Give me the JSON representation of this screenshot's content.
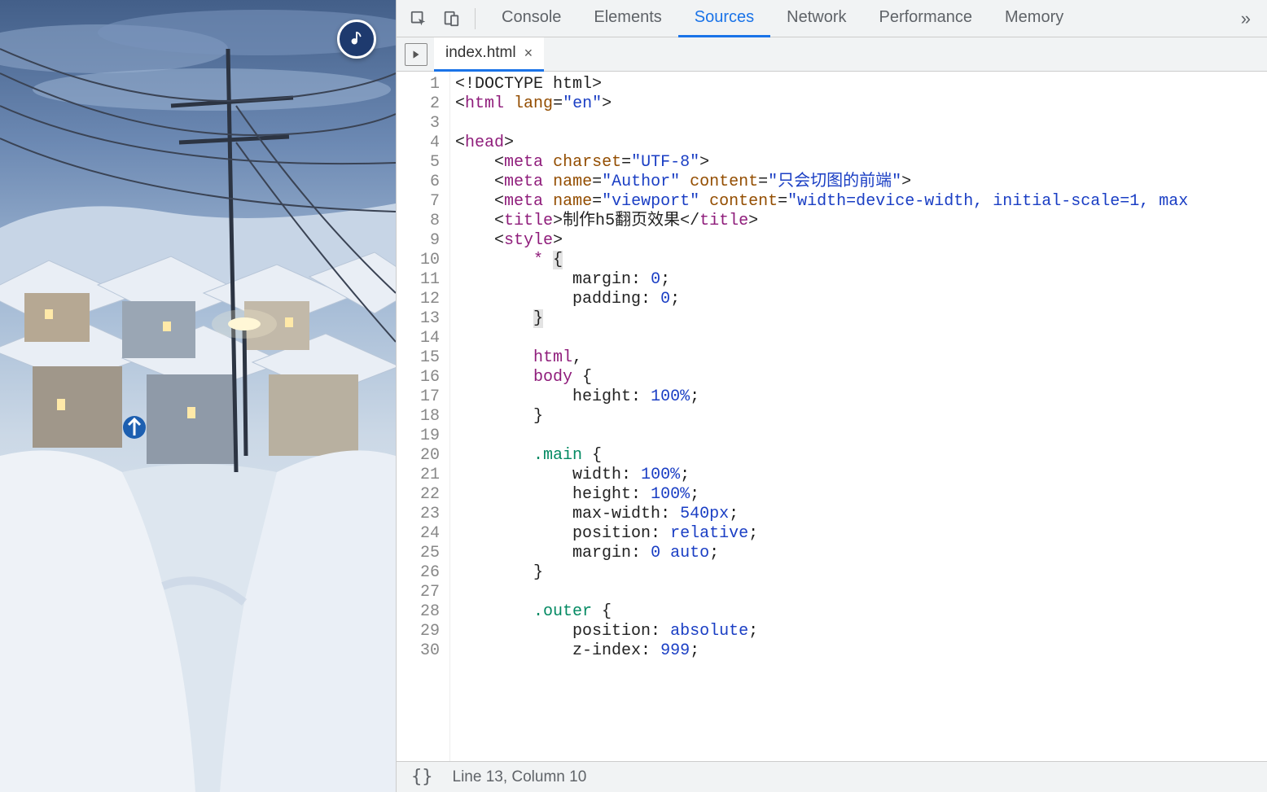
{
  "devtools": {
    "tabs": [
      "Console",
      "Elements",
      "Sources",
      "Network",
      "Performance",
      "Memory"
    ],
    "active_tab": "Sources",
    "more_glyph": "»"
  },
  "file": {
    "name": "index.html",
    "close_glyph": "×"
  },
  "status": {
    "braces": "{}",
    "position": "Line 13, Column 10"
  },
  "code_lines": [
    [
      {
        "c": "t-doctype",
        "t": "<!DOCTYPE html>"
      }
    ],
    [
      {
        "c": "t-punct",
        "t": "<"
      },
      {
        "c": "t-tag",
        "t": "html"
      },
      {
        "c": "",
        "t": " "
      },
      {
        "c": "t-attr",
        "t": "lang"
      },
      {
        "c": "t-punct",
        "t": "="
      },
      {
        "c": "t-str",
        "t": "\"en\""
      },
      {
        "c": "t-punct",
        "t": ">"
      }
    ],
    [],
    [
      {
        "c": "t-punct",
        "t": "<"
      },
      {
        "c": "t-tag",
        "t": "head"
      },
      {
        "c": "t-punct",
        "t": ">"
      }
    ],
    [
      {
        "c": "",
        "t": "    "
      },
      {
        "c": "t-punct",
        "t": "<"
      },
      {
        "c": "t-tag",
        "t": "meta"
      },
      {
        "c": "",
        "t": " "
      },
      {
        "c": "t-attr",
        "t": "charset"
      },
      {
        "c": "t-punct",
        "t": "="
      },
      {
        "c": "t-str",
        "t": "\"UTF-8\""
      },
      {
        "c": "t-punct",
        "t": ">"
      }
    ],
    [
      {
        "c": "",
        "t": "    "
      },
      {
        "c": "t-punct",
        "t": "<"
      },
      {
        "c": "t-tag",
        "t": "meta"
      },
      {
        "c": "",
        "t": " "
      },
      {
        "c": "t-attr",
        "t": "name"
      },
      {
        "c": "t-punct",
        "t": "="
      },
      {
        "c": "t-str",
        "t": "\"Author\""
      },
      {
        "c": "",
        "t": " "
      },
      {
        "c": "t-attr",
        "t": "content"
      },
      {
        "c": "t-punct",
        "t": "="
      },
      {
        "c": "t-str",
        "t": "\"只会切图的前端\""
      },
      {
        "c": "t-punct",
        "t": ">"
      }
    ],
    [
      {
        "c": "",
        "t": "    "
      },
      {
        "c": "t-punct",
        "t": "<"
      },
      {
        "c": "t-tag",
        "t": "meta"
      },
      {
        "c": "",
        "t": " "
      },
      {
        "c": "t-attr",
        "t": "name"
      },
      {
        "c": "t-punct",
        "t": "="
      },
      {
        "c": "t-str",
        "t": "\"viewport\""
      },
      {
        "c": "",
        "t": " "
      },
      {
        "c": "t-attr",
        "t": "content"
      },
      {
        "c": "t-punct",
        "t": "="
      },
      {
        "c": "t-str",
        "t": "\"width=device-width, initial-scale=1, max"
      }
    ],
    [
      {
        "c": "",
        "t": "    "
      },
      {
        "c": "t-punct",
        "t": "<"
      },
      {
        "c": "t-tag",
        "t": "title"
      },
      {
        "c": "t-punct",
        "t": ">"
      },
      {
        "c": "t-text",
        "t": "制作h5翻页效果"
      },
      {
        "c": "t-punct",
        "t": "</"
      },
      {
        "c": "t-tag",
        "t": "title"
      },
      {
        "c": "t-punct",
        "t": ">"
      }
    ],
    [
      {
        "c": "",
        "t": "    "
      },
      {
        "c": "t-punct",
        "t": "<"
      },
      {
        "c": "t-tag",
        "t": "style"
      },
      {
        "c": "t-punct",
        "t": ">"
      }
    ],
    [
      {
        "c": "",
        "t": "        "
      },
      {
        "c": "t-sel",
        "t": "*"
      },
      {
        "c": "",
        "t": " "
      },
      {
        "c": "caret-block",
        "t": "{"
      }
    ],
    [
      {
        "c": "",
        "t": "            "
      },
      {
        "c": "t-prop",
        "t": "margin"
      },
      {
        "c": "t-punct",
        "t": ": "
      },
      {
        "c": "t-num",
        "t": "0"
      },
      {
        "c": "t-punct",
        "t": ";"
      }
    ],
    [
      {
        "c": "",
        "t": "            "
      },
      {
        "c": "t-prop",
        "t": "padding"
      },
      {
        "c": "t-punct",
        "t": ": "
      },
      {
        "c": "t-num",
        "t": "0"
      },
      {
        "c": "t-punct",
        "t": ";"
      }
    ],
    [
      {
        "c": "",
        "t": "        "
      },
      {
        "c": "caret-block",
        "t": "}"
      }
    ],
    [],
    [
      {
        "c": "",
        "t": "        "
      },
      {
        "c": "t-sel",
        "t": "html"
      },
      {
        "c": "t-punct",
        "t": ","
      }
    ],
    [
      {
        "c": "",
        "t": "        "
      },
      {
        "c": "t-sel",
        "t": "body"
      },
      {
        "c": "",
        "t": " "
      },
      {
        "c": "t-punct",
        "t": "{"
      }
    ],
    [
      {
        "c": "",
        "t": "            "
      },
      {
        "c": "t-prop",
        "t": "height"
      },
      {
        "c": "t-punct",
        "t": ": "
      },
      {
        "c": "t-num",
        "t": "100%"
      },
      {
        "c": "t-punct",
        "t": ";"
      }
    ],
    [
      {
        "c": "",
        "t": "        "
      },
      {
        "c": "t-punct",
        "t": "}"
      }
    ],
    [],
    [
      {
        "c": "",
        "t": "        "
      },
      {
        "c": "t-class",
        "t": ".main"
      },
      {
        "c": "",
        "t": " "
      },
      {
        "c": "t-punct",
        "t": "{"
      }
    ],
    [
      {
        "c": "",
        "t": "            "
      },
      {
        "c": "t-prop",
        "t": "width"
      },
      {
        "c": "t-punct",
        "t": ": "
      },
      {
        "c": "t-num",
        "t": "100%"
      },
      {
        "c": "t-punct",
        "t": ";"
      }
    ],
    [
      {
        "c": "",
        "t": "            "
      },
      {
        "c": "t-prop",
        "t": "height"
      },
      {
        "c": "t-punct",
        "t": ": "
      },
      {
        "c": "t-num",
        "t": "100%"
      },
      {
        "c": "t-punct",
        "t": ";"
      }
    ],
    [
      {
        "c": "",
        "t": "            "
      },
      {
        "c": "t-prop",
        "t": "max-width"
      },
      {
        "c": "t-punct",
        "t": ": "
      },
      {
        "c": "t-num",
        "t": "540px"
      },
      {
        "c": "t-punct",
        "t": ";"
      }
    ],
    [
      {
        "c": "",
        "t": "            "
      },
      {
        "c": "t-prop",
        "t": "position"
      },
      {
        "c": "t-punct",
        "t": ": "
      },
      {
        "c": "t-num",
        "t": "relative"
      },
      {
        "c": "t-punct",
        "t": ";"
      }
    ],
    [
      {
        "c": "",
        "t": "            "
      },
      {
        "c": "t-prop",
        "t": "margin"
      },
      {
        "c": "t-punct",
        "t": ": "
      },
      {
        "c": "t-num",
        "t": "0"
      },
      {
        "c": "",
        "t": " "
      },
      {
        "c": "t-num",
        "t": "auto"
      },
      {
        "c": "t-punct",
        "t": ";"
      }
    ],
    [
      {
        "c": "",
        "t": "        "
      },
      {
        "c": "t-punct",
        "t": "}"
      }
    ],
    [],
    [
      {
        "c": "",
        "t": "        "
      },
      {
        "c": "t-class",
        "t": ".outer"
      },
      {
        "c": "",
        "t": " "
      },
      {
        "c": "t-punct",
        "t": "{"
      }
    ],
    [
      {
        "c": "",
        "t": "            "
      },
      {
        "c": "t-prop",
        "t": "position"
      },
      {
        "c": "t-punct",
        "t": ": "
      },
      {
        "c": "t-num",
        "t": "absolute"
      },
      {
        "c": "t-punct",
        "t": ";"
      }
    ],
    [
      {
        "c": "",
        "t": "            "
      },
      {
        "c": "t-prop",
        "t": "z-index"
      },
      {
        "c": "t-punct",
        "t": ": "
      },
      {
        "c": "t-num",
        "t": "999"
      },
      {
        "c": "t-punct",
        "t": ";"
      }
    ]
  ]
}
